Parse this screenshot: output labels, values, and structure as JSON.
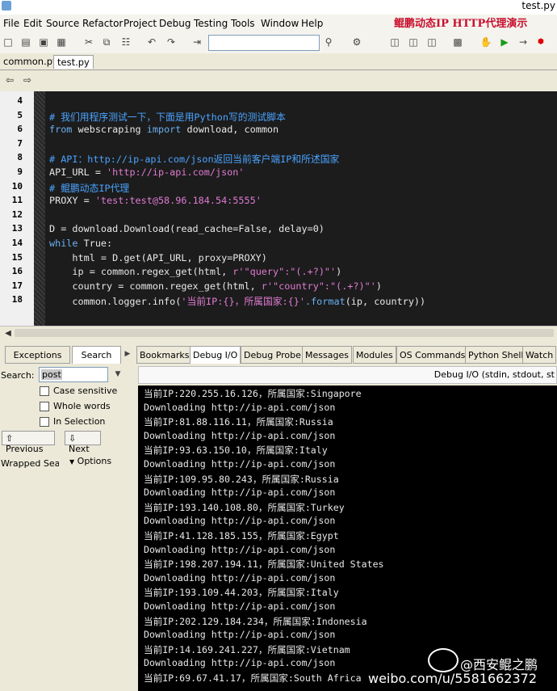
{
  "window": {
    "title": "test.py"
  },
  "menu": {
    "items": [
      "File",
      "Edit",
      "Source",
      "Refactor",
      "Project",
      "Debug",
      "Testing",
      "Tools",
      "Window",
      "Help"
    ],
    "watermark": "鲲鹏动态IP HTTP代理演示"
  },
  "file_tabs": [
    "common.py",
    "test.py"
  ],
  "editor": {
    "lines": [
      {
        "n": "4",
        "segs": []
      },
      {
        "n": "5",
        "segs": [
          {
            "c": "cm",
            "t": "# 我们用程序测试一下，下面是用Python写的测试脚本"
          }
        ]
      },
      {
        "n": "6",
        "segs": [
          {
            "c": "kw",
            "t": "from"
          },
          {
            "c": "nm",
            "t": " webscraping "
          },
          {
            "c": "kw",
            "t": "import"
          },
          {
            "c": "nm",
            "t": " download, common"
          }
        ]
      },
      {
        "n": "7",
        "segs": []
      },
      {
        "n": "8",
        "segs": [
          {
            "c": "cm",
            "t": "# API：http://ip-api.com/json返回当前客户端IP和所述国家"
          }
        ]
      },
      {
        "n": "9",
        "segs": [
          {
            "c": "nm",
            "t": "API_URL = "
          },
          {
            "c": "st",
            "t": "'http://ip-api.com/json'"
          }
        ]
      },
      {
        "n": "10",
        "segs": [
          {
            "c": "cm",
            "t": "# 鲲鹏动态IP代理"
          }
        ]
      },
      {
        "n": "11",
        "segs": [
          {
            "c": "nm",
            "t": "PROXY = "
          },
          {
            "c": "st",
            "t": "'test:test@58.96.184.54:5555'"
          }
        ]
      },
      {
        "n": "12",
        "segs": []
      },
      {
        "n": "13",
        "segs": [
          {
            "c": "nm",
            "t": "D = download.Download(read_cache=False, delay=0)"
          }
        ]
      },
      {
        "n": "14",
        "segs": [
          {
            "c": "kw",
            "t": "while"
          },
          {
            "c": "nm",
            "t": " True:"
          }
        ]
      },
      {
        "n": "15",
        "segs": [
          {
            "c": "nm",
            "t": "    html = D.get(API_URL, proxy=PROXY)"
          }
        ]
      },
      {
        "n": "16",
        "segs": [
          {
            "c": "nm",
            "t": "    ip = common.regex_get(html, "
          },
          {
            "c": "st",
            "t": "r'\"query\":\"(.+?)\"'"
          },
          {
            "c": "nm",
            "t": ")"
          }
        ]
      },
      {
        "n": "17",
        "segs": [
          {
            "c": "nm",
            "t": "    country = common.regex_get(html, "
          },
          {
            "c": "st",
            "t": "r'\"country\":\"(.+?)\"'"
          },
          {
            "c": "nm",
            "t": ")"
          }
        ]
      },
      {
        "n": "18",
        "segs": [
          {
            "c": "nm",
            "t": "    common.logger.info("
          },
          {
            "c": "st",
            "t": "'当前IP:{}，所属国家:{}'"
          },
          {
            "c": "kw",
            "t": ".format"
          },
          {
            "c": "nm",
            "t": "(ip, country))"
          }
        ]
      }
    ]
  },
  "left_panel": {
    "tabs": [
      "Exceptions",
      "Search"
    ],
    "search_label": "Search:",
    "search_value": "post",
    "options": [
      "Case sensitive",
      "Whole words",
      "In Selection"
    ],
    "previous": "Previous",
    "next": "Next",
    "wrapped": "Wrapped Sea",
    "options_button": "Options"
  },
  "right_panel": {
    "tabs": [
      "Bookmarks",
      "Debug I/O",
      "Debug Probe",
      "Messages",
      "Modules",
      "OS Commands",
      "Python Shell",
      "Watch"
    ],
    "header": "Debug I/O (stdin, stdout, st",
    "output": [
      "当前IP:220.255.16.126，所属国家:Singapore",
      "Downloading http://ip-api.com/json",
      "当前IP:81.88.116.11，所属国家:Russia",
      "Downloading http://ip-api.com/json",
      "当前IP:93.63.150.10，所属国家:Italy",
      "Downloading http://ip-api.com/json",
      "当前IP:109.95.80.243，所属国家:Russia",
      "Downloading http://ip-api.com/json",
      "当前IP:193.140.108.80，所属国家:Turkey",
      "Downloading http://ip-api.com/json",
      "当前IP:41.128.185.155，所属国家:Egypt",
      "Downloading http://ip-api.com/json",
      "当前IP:198.207.194.11，所属国家:United States",
      "Downloading http://ip-api.com/json",
      "当前IP:193.109.44.203，所属国家:Italy",
      "Downloading http://ip-api.com/json",
      "当前IP:202.129.184.234，所属国家:Indonesia",
      "Downloading http://ip-api.com/json",
      "当前IP:14.169.241.227，所属国家:Vietnam",
      "Downloading http://ip-api.com/json",
      "当前IP:69.67.41.17，所属国家:South Africa"
    ]
  },
  "overlay": {
    "handle": "@西安鲲之鹏",
    "url": "weibo.com/u/5581662372"
  }
}
